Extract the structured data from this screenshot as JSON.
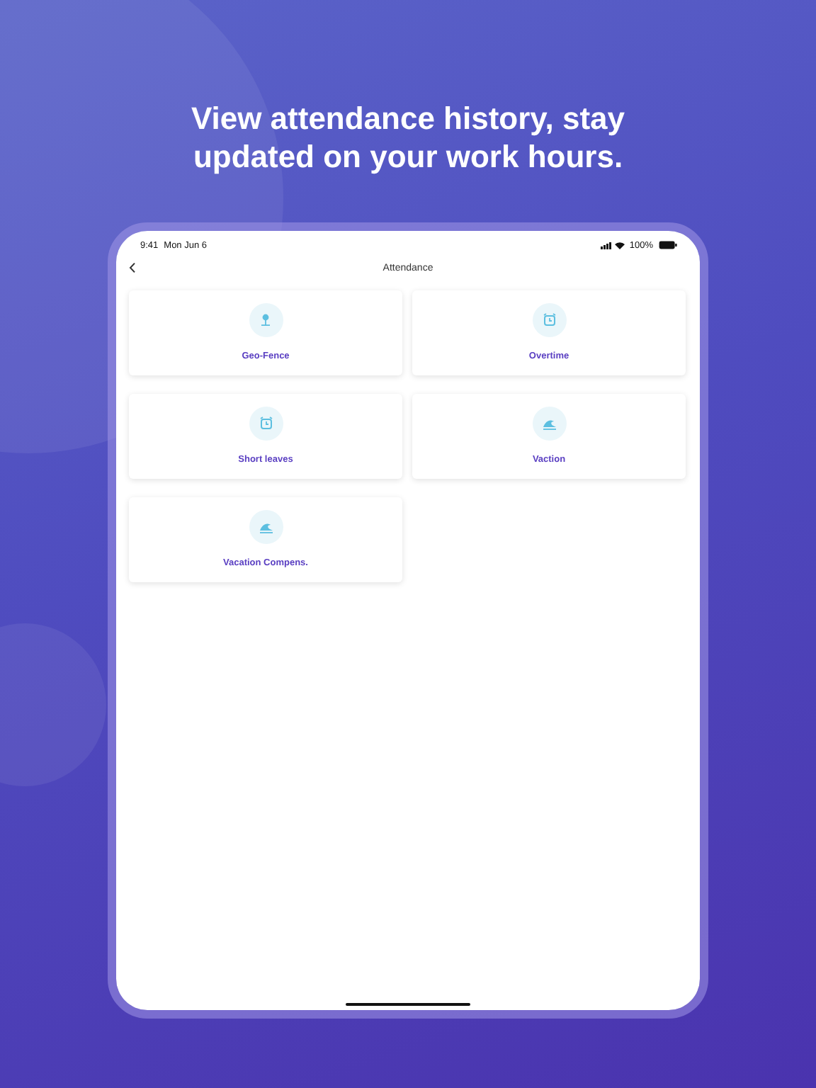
{
  "headline": "View attendance history, stay updated on your work hours.",
  "status_bar": {
    "time": "9:41",
    "date": "Mon Jun 6",
    "battery": "100%"
  },
  "nav": {
    "title": "Attendance"
  },
  "tiles": [
    {
      "label": "Geo-Fence",
      "kind": "pin"
    },
    {
      "label": "Overtime",
      "kind": "alarm"
    },
    {
      "label": "Short leaves",
      "kind": "alarm"
    },
    {
      "label": "Vaction",
      "kind": "wave"
    },
    {
      "label": "Vacation Compens.",
      "kind": "wave"
    }
  ]
}
